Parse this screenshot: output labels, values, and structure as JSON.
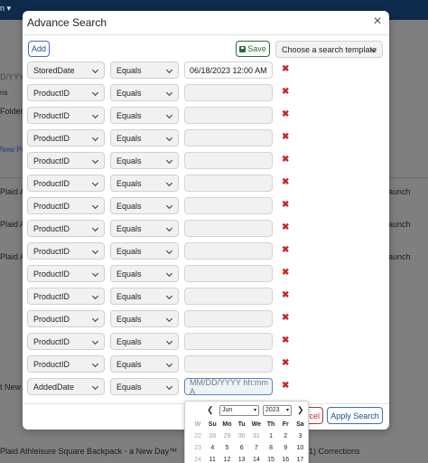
{
  "background": {
    "menu_label": "n ▾",
    "text_placeholder": "D/YYYY",
    "text_ns": "ns",
    "text_folder": "Folder",
    "text_new_pro": "New Pro",
    "row_texts": [
      "Plaid A",
      "Plaid A",
      "Plaid A"
    ],
    "right_texts": [
      "aunch",
      "aunch",
      "aunch"
    ],
    "text_t_new": "t New",
    "bottom_text": "Plaid Athleisure Square Backpack - a New Day™",
    "bottom_right": "1) Corrections"
  },
  "modal": {
    "title": "Advance Search",
    "close_label": "×",
    "add_label": "Add",
    "save_label": "Save",
    "template_placeholder": "Choose a search template",
    "cancel_label": "cel",
    "apply_label": "Apply Search",
    "remove_label": "✖"
  },
  "criteria": [
    {
      "field": "StoredDate",
      "operator": "Equals",
      "value": "06/18/2023 12:00 AM",
      "placeholder": ""
    },
    {
      "field": "ProductID",
      "operator": "Equals",
      "value": "",
      "placeholder": ""
    },
    {
      "field": "ProductID",
      "operator": "Equals",
      "value": "",
      "placeholder": ""
    },
    {
      "field": "ProductID",
      "operator": "Equals",
      "value": "",
      "placeholder": ""
    },
    {
      "field": "ProductID",
      "operator": "Equals",
      "value": "",
      "placeholder": ""
    },
    {
      "field": "ProductID",
      "operator": "Equals",
      "value": "",
      "placeholder": ""
    },
    {
      "field": "ProductID",
      "operator": "Equals",
      "value": "",
      "placeholder": ""
    },
    {
      "field": "ProductID",
      "operator": "Equals",
      "value": "",
      "placeholder": ""
    },
    {
      "field": "ProductID",
      "operator": "Equals",
      "value": "",
      "placeholder": ""
    },
    {
      "field": "ProductID",
      "operator": "Equals",
      "value": "",
      "placeholder": ""
    },
    {
      "field": "ProductID",
      "operator": "Equals",
      "value": "",
      "placeholder": ""
    },
    {
      "field": "ProductID",
      "operator": "Equals",
      "value": "",
      "placeholder": ""
    },
    {
      "field": "ProductID",
      "operator": "Equals",
      "value": "",
      "placeholder": ""
    },
    {
      "field": "ProductID",
      "operator": "Equals",
      "value": "",
      "placeholder": ""
    },
    {
      "field": "AddedDate",
      "operator": "Equals",
      "value": "",
      "placeholder": "MM/DD/YYYY hh:mm A"
    }
  ],
  "datepicker": {
    "prev": "❮",
    "next": "❯",
    "month": "Jun",
    "year": "2023",
    "weekday_headers": [
      "W",
      "Su",
      "Mo",
      "Tu",
      "We",
      "Th",
      "Fr",
      "Sa"
    ],
    "weeks": [
      [
        "22",
        "28",
        "29",
        "30",
        "31",
        "1",
        "2",
        "3"
      ],
      [
        "23",
        "4",
        "5",
        "6",
        "7",
        "8",
        "9",
        "10"
      ],
      [
        "24",
        "11",
        "12",
        "13",
        "14",
        "15",
        "16",
        "17"
      ]
    ]
  },
  "colors": {
    "accent": "#3d6fb7",
    "remove": "#c62828",
    "save": "#2d6a3a",
    "topbar": "#0e2a4d"
  }
}
